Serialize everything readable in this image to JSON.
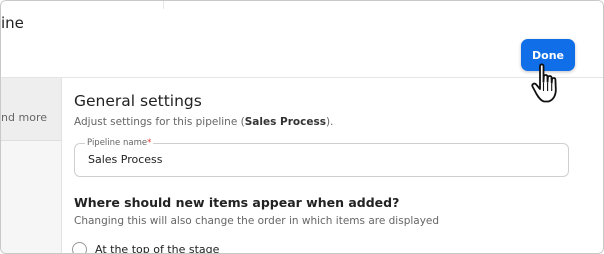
{
  "header": {
    "partial_title": "ine",
    "done_label": "Done"
  },
  "sidebar": {
    "items": [
      {
        "label": "nd more"
      }
    ]
  },
  "general": {
    "title": "General settings",
    "desc_prefix": "Adjust settings for this pipeline (",
    "desc_pipeline": "Sales Process",
    "desc_suffix": ").",
    "field_label": "Pipeline name",
    "field_required_mark": "*",
    "field_value": "Sales Process"
  },
  "placement": {
    "question": "Where should new items appear when added?",
    "description": "Changing this will also change the order in which items are displayed",
    "options": [
      {
        "label": "At the top of the stage"
      }
    ]
  },
  "colors": {
    "accent": "#0f6ee8",
    "required": "#e03535"
  },
  "icons": {
    "cursor": "hand-pointer-cursor-icon"
  }
}
